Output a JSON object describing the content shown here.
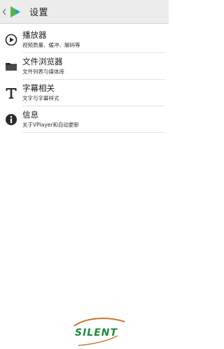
{
  "header": {
    "title": "设置",
    "back_icon": "chevron-left-icon",
    "logo_icon": "vplayer-logo-icon"
  },
  "settings": {
    "items": [
      {
        "title": "播放器",
        "subtitle": "视频质量、缓冲、解码等",
        "icon": "play-circle-icon"
      },
      {
        "title": "文件浏览器",
        "subtitle": "文件列表与媒体库",
        "icon": "folder-icon"
      },
      {
        "title": "字幕相关",
        "subtitle": "文字与字幕样式",
        "icon": "text-t-icon"
      },
      {
        "title": "信息",
        "subtitle": "关于VPlayer和自动更新",
        "icon": "info-icon"
      }
    ]
  },
  "watermark": {
    "text": "SILENT"
  },
  "colors": {
    "toolbar_bg": "#ececec",
    "icon_dark": "#2b2b2b",
    "watermark_green": "#1e8a3c",
    "watermark_orange": "#c9762f",
    "logo_teal": "#2ec4c0",
    "logo_green": "#55b94a"
  }
}
